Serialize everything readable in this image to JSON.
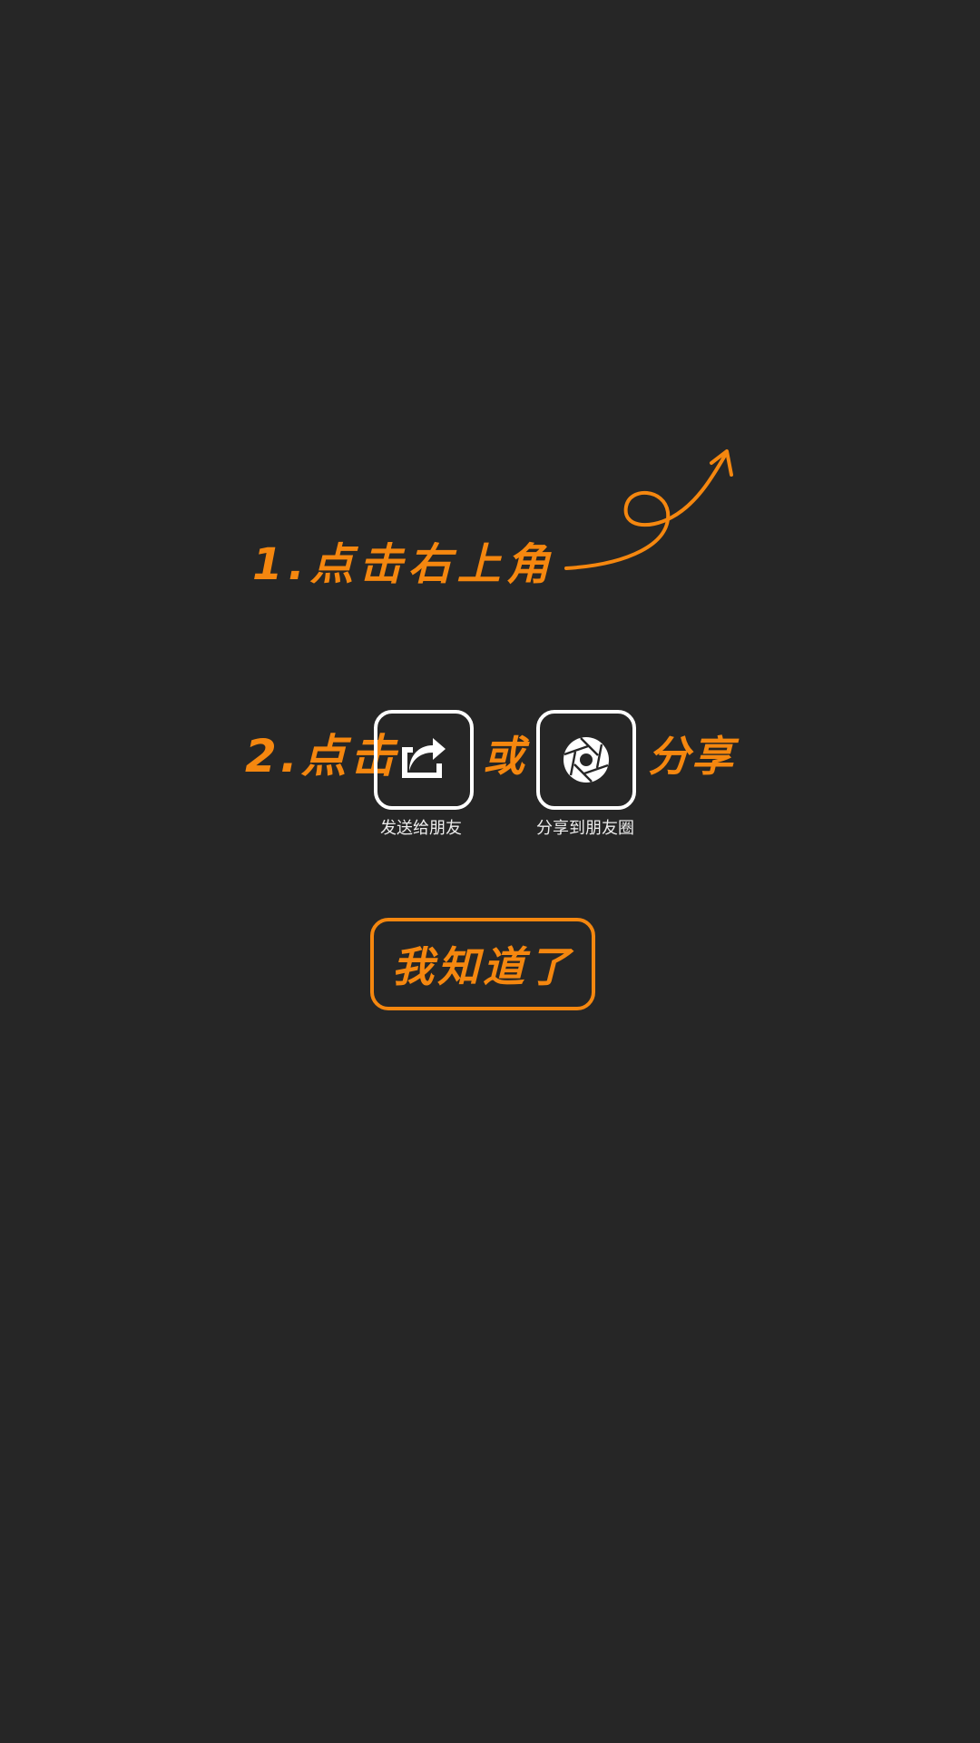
{
  "colors": {
    "background": "#262626",
    "accent": "#f5870f",
    "icon": "#ffffff",
    "caption": "#ededed"
  },
  "guide": {
    "step1": {
      "text": "1.点击右上角",
      "arrow_icon": "curly-arrow-up-right-icon"
    },
    "step2": {
      "prefix": "2.点击",
      "or": "或",
      "suffix": "分享",
      "options": [
        {
          "icon": "forward-share-icon",
          "caption": "发送给朋友"
        },
        {
          "icon": "camera-aperture-icon",
          "caption": "分享到朋友圈"
        }
      ]
    },
    "dismiss_button": {
      "label": "我知道了"
    }
  }
}
